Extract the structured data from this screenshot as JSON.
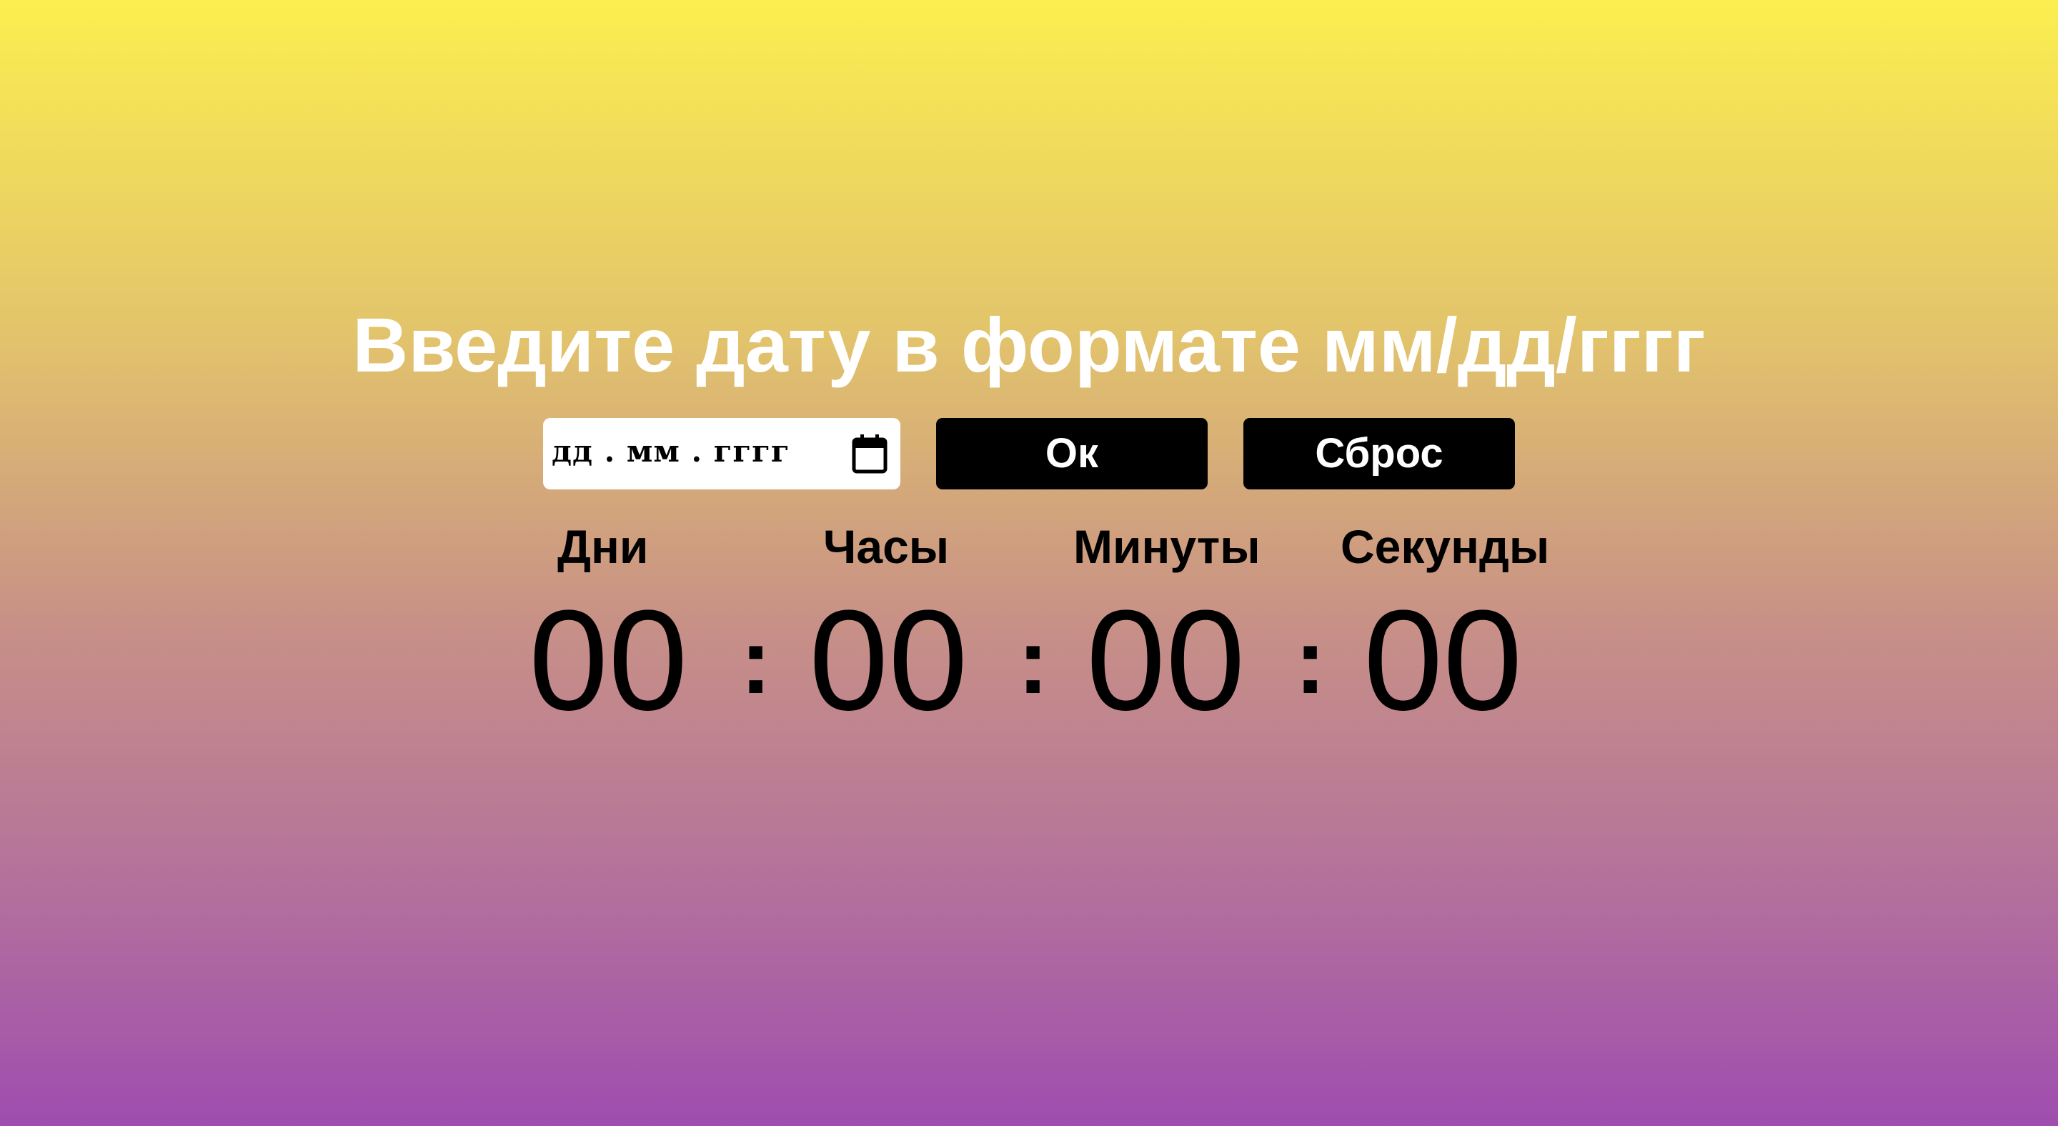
{
  "header": {
    "title": "Введите дату в формате мм/дд/гггг"
  },
  "form": {
    "date_placeholder": "дд . мм . гггг",
    "calendar_icon": "calendar-icon",
    "ok_label": "Ок",
    "reset_label": "Сброс"
  },
  "timer": {
    "labels": {
      "days": "Дни",
      "hours": "Часы",
      "minutes": "Минуты",
      "seconds": "Секунды"
    },
    "values": {
      "days": "00",
      "hours": "00",
      "minutes": "00",
      "seconds": "00"
    },
    "separator": ":"
  },
  "colors": {
    "gradient_top": "#FCEE4F",
    "gradient_bottom": "#9F4DAF",
    "button_bg": "#000000",
    "button_text": "#ffffff"
  }
}
